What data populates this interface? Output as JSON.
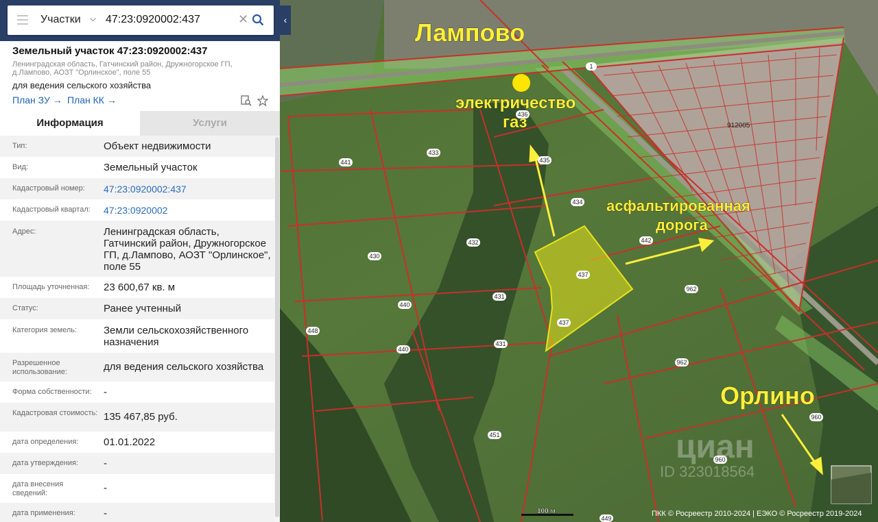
{
  "search": {
    "layer": "Участки",
    "query": "47:23:0920002:437"
  },
  "parcel": {
    "title": "Земельный участок 47:23:0920002:437",
    "address_short": "Ленинградская область, Гатчинский район, Дружногорское ГП, д.Лампово, АОЗТ \"Орлинское\", поле 55",
    "purpose": "для ведения сельского хозяйства",
    "link_plan_zu": "План ЗУ",
    "link_plan_kk": "План КК"
  },
  "tabs": [
    "Информация",
    "Услуги"
  ],
  "info": [
    {
      "label": "Тип:",
      "value": "Объект недвижимости"
    },
    {
      "label": "Вид:",
      "value": "Земельный участок"
    },
    {
      "label": "Кадастровый номер:",
      "value": "47:23:0920002:437"
    },
    {
      "label": "Кадастровый квартал:",
      "value": "47:23:0920002"
    },
    {
      "label": "Адрес:",
      "value": "Ленинградская область, Гатчинский район, Дружногорское ГП, д.Лампово, АОЗТ \"Орлинское\", поле 55"
    },
    {
      "label": "Площадь уточненная:",
      "value": "23 600,67 кв. м"
    },
    {
      "label": "Статус:",
      "value": "Ранее учтенный"
    },
    {
      "label": "Категория земель:",
      "value": "Земли сельскохозяйственного назначения"
    },
    {
      "label": "Разрешенное использование:",
      "value": "для ведения сельского хозяйства"
    },
    {
      "label": "Форма собственности:",
      "value": "-"
    },
    {
      "label": "Кадастровая стоимость:",
      "value": "135 467,85 руб."
    },
    {
      "label": "дата определения:",
      "value": "01.01.2022"
    },
    {
      "label": "дата утверждения:",
      "value": "-"
    },
    {
      "label": "дата внесения сведений:",
      "value": "-"
    },
    {
      "label": "дата применения:",
      "value": "-"
    }
  ],
  "map": {
    "annotations": {
      "village_lampovo": "Лампово",
      "village_orlino": "Орлино",
      "utilities": "электричество\nгаз",
      "road": "асфальтированная\nдорога"
    },
    "plot_numbers": [
      "441",
      "433",
      "436",
      "435",
      "434",
      "432",
      "430",
      "440",
      "431",
      "448",
      "440",
      "431",
      "442",
      "437",
      "437",
      "962",
      "962",
      "960",
      "960",
      "451",
      "449",
      "1"
    ],
    "block_label": "912005",
    "watermark_brand": "циан",
    "watermark_id": "ID 323018564",
    "scale_label": "100 м",
    "copyright": "ПКК © Росреестр 2010-2024 | ЕЭКО © Росреестр 2019-2024"
  },
  "colors": {
    "link": "#1f64b4",
    "highlight": "#e8e31b",
    "boundary": "#c8302a",
    "zone": "#8ed36a"
  }
}
